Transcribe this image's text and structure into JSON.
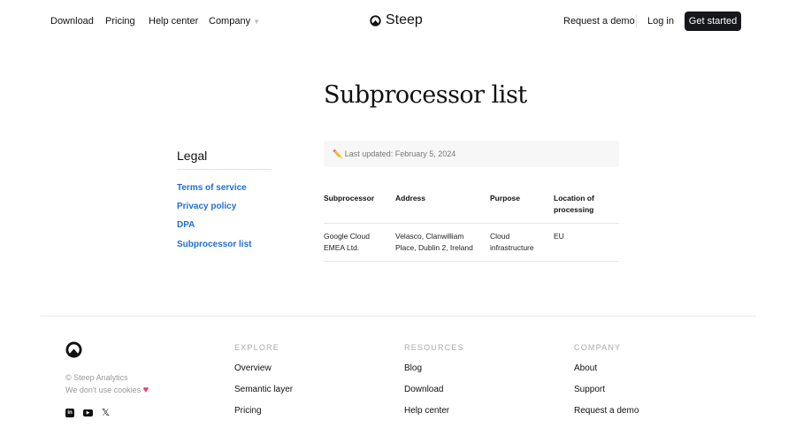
{
  "nav": {
    "left": [
      "Download",
      "Pricing",
      "Help center",
      "Company"
    ],
    "brand": "Steep",
    "request_demo": "Request a demo",
    "login": "Log in",
    "get_started": "Get started"
  },
  "page": {
    "title": "Subprocessor list",
    "last_updated": "✏️ Last updated: February 5, 2024"
  },
  "sidebar": {
    "heading": "Legal",
    "links": [
      "Terms of service",
      "Privacy policy",
      "DPA",
      "Subprocessor list"
    ]
  },
  "table": {
    "headers": [
      "Subprocessor",
      "Address",
      "Purpose",
      "Location of processing"
    ],
    "rows": [
      [
        "Google Cloud EMEA Ltd.",
        "Velasco, Clanwilliam Place, Dublin 2, Ireland",
        "Cloud infrastructure",
        "EU"
      ]
    ]
  },
  "footer": {
    "copyright": "© Steep Analytics",
    "cookies": "We don't use cookies",
    "columns": [
      {
        "title": "EXPLORE",
        "links": [
          "Overview",
          "Semantic layer",
          "Pricing"
        ]
      },
      {
        "title": "RESOURCES",
        "links": [
          "Blog",
          "Download",
          "Help center"
        ]
      },
      {
        "title": "COMPANY",
        "links": [
          "About",
          "Support",
          "Request a demo"
        ]
      }
    ]
  },
  "colors": {
    "link": "#1f6fd1",
    "heart": "#e8416f"
  }
}
